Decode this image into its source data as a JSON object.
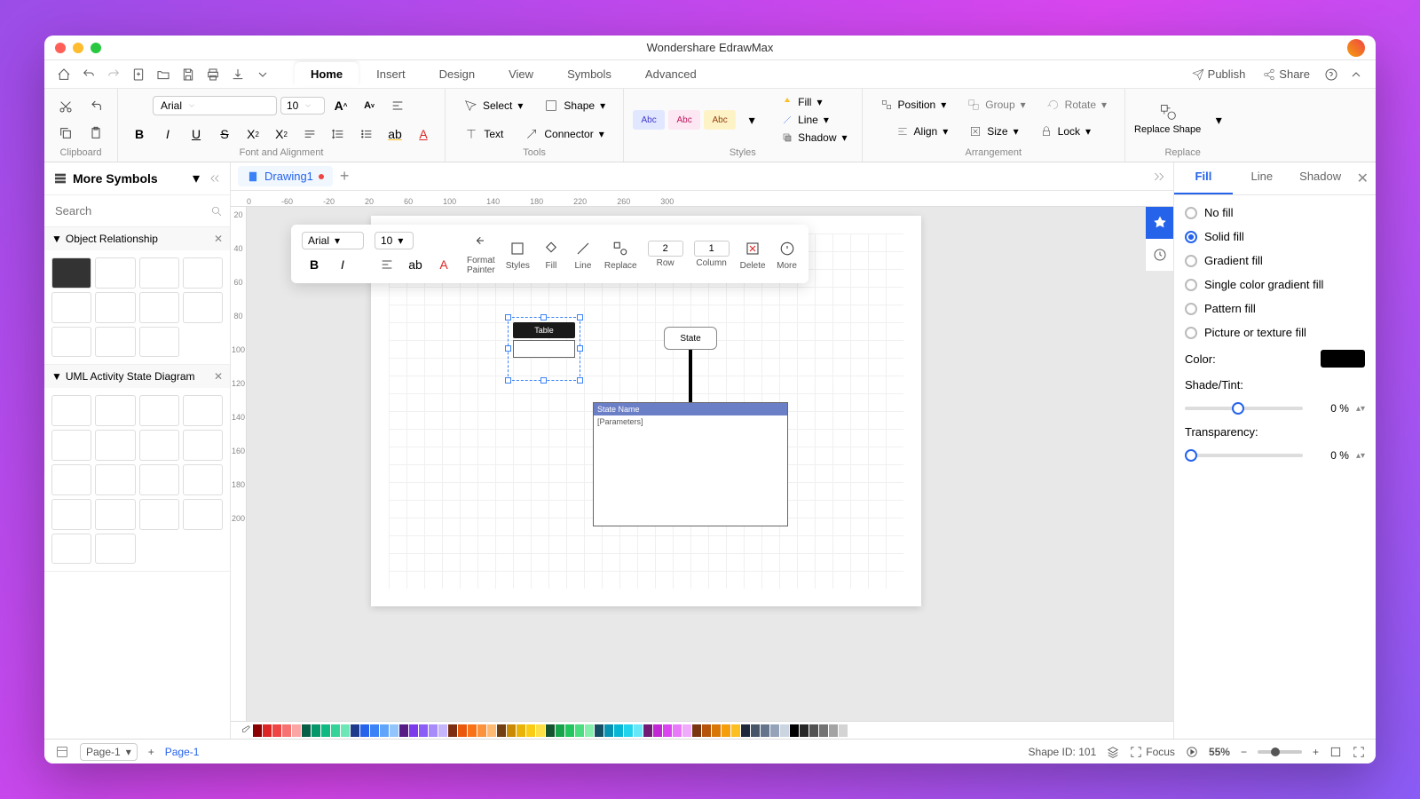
{
  "window": {
    "title": "Wondershare EdrawMax"
  },
  "menubar": {
    "publish": "Publish",
    "share": "Share"
  },
  "tabs": [
    "Home",
    "Insert",
    "Design",
    "View",
    "Symbols",
    "Advanced"
  ],
  "active_tab": 0,
  "ribbon": {
    "clipboard": "Clipboard",
    "font_alignment": "Font and Alignment",
    "tools": "Tools",
    "styles": "Styles",
    "arrangement": "Arrangement",
    "replace": "Replace",
    "font": "Arial",
    "size": "10",
    "select": "Select",
    "shape": "Shape",
    "text": "Text",
    "connector": "Connector",
    "fill": "Fill",
    "line": "Line",
    "shadow": "Shadow",
    "position": "Position",
    "group": "Group",
    "rotate": "Rotate",
    "align": "Align",
    "size_btn": "Size",
    "lock": "Lock",
    "replace_shape": "Replace\nShape",
    "abc": "Abc"
  },
  "leftpanel": {
    "title": "More Symbols",
    "search_ph": "Search",
    "section1": "Object Relationship",
    "section2": "UML Activity State Diagram"
  },
  "doctab": {
    "name": "Drawing1"
  },
  "ruler_h": [
    "0",
    "-60",
    "-20",
    "20",
    "60",
    "100",
    "140",
    "180",
    "220",
    "260",
    "300"
  ],
  "ruler_v": [
    "20",
    "40",
    "60",
    "80",
    "100",
    "120",
    "140",
    "160",
    "180",
    "200"
  ],
  "float": {
    "font": "Arial",
    "size": "10",
    "format_painter": "Format\nPainter",
    "styles": "Styles",
    "fill": "Fill",
    "line": "Line",
    "replace": "Replace",
    "row": "Row",
    "column": "Column",
    "delete": "Delete",
    "more": "More",
    "r": "2",
    "c": "1"
  },
  "shapes": {
    "table": "Table",
    "state": "State",
    "statename": "State Name",
    "params": "[Parameters]"
  },
  "rightpanel": {
    "tabs": [
      "Fill",
      "Line",
      "Shadow"
    ],
    "nofill": "No fill",
    "solid": "Solid fill",
    "gradient": "Gradient fill",
    "single": "Single color gradient fill",
    "pattern": "Pattern fill",
    "picture": "Picture or texture fill",
    "color": "Color:",
    "shade": "Shade/Tint:",
    "trans": "Transparency:",
    "shade_val": "0 %",
    "trans_val": "0 %"
  },
  "status": {
    "page": "Page-1",
    "page_tab": "Page-1",
    "shapeid": "Shape ID: 101",
    "focus": "Focus",
    "zoom": "55%"
  },
  "colors": [
    "#8b0000",
    "#dc2626",
    "#ef4444",
    "#f87171",
    "#fca5a5",
    "#065f46",
    "#059669",
    "#10b981",
    "#34d399",
    "#6ee7b7",
    "#1e3a8a",
    "#2563eb",
    "#3b82f6",
    "#60a5fa",
    "#93c5fd",
    "#581c87",
    "#7c3aed",
    "#8b5cf6",
    "#a78bfa",
    "#c4b5fd",
    "#7c2d12",
    "#ea580c",
    "#f97316",
    "#fb923c",
    "#fdba74",
    "#713f12",
    "#ca8a04",
    "#eab308",
    "#facc15",
    "#fde047",
    "#14532d",
    "#16a34a",
    "#22c55e",
    "#4ade80",
    "#86efac",
    "#164e63",
    "#0891b2",
    "#06b6d4",
    "#22d3ee",
    "#67e8f9",
    "#701a75",
    "#c026d3",
    "#d946ef",
    "#e879f9",
    "#f0abfc",
    "#78350f",
    "#b45309",
    "#d97706",
    "#f59e0b",
    "#fbbf24",
    "#1e293b",
    "#475569",
    "#64748b",
    "#94a3b8",
    "#cbd5e1",
    "#000",
    "#262626",
    "#525252",
    "#737373",
    "#a3a3a3",
    "#d4d4d4",
    "#fff"
  ]
}
